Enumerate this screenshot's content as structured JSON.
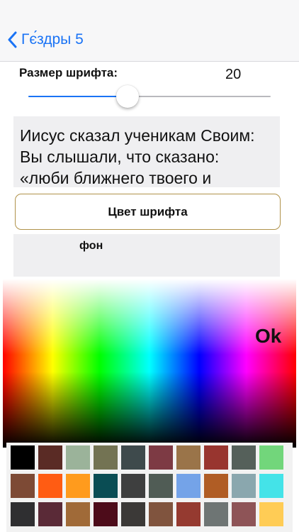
{
  "nav": {
    "back_label": "Гє́здры 5",
    "back_icon": "chevron-left-icon"
  },
  "font_size": {
    "label": "Размер шрифта:",
    "value": "20",
    "level": 0.41
  },
  "preview": {
    "text": "Иисус сказал ученикам Своим: Вы слышали, что сказано: «люби ближнего твоего и ненавидь врага твоего»."
  },
  "font_color_button": {
    "label": "Цвет шрифта"
  },
  "background": {
    "label": "фон"
  },
  "picker": {
    "ok_label": "Ok"
  },
  "swatches": [
    "#000000",
    "#5a2b25",
    "#9bb39a",
    "#737353",
    "#3e4a4c",
    "#7d3a44",
    "#9a7449",
    "#98352f",
    "#55605a",
    "#72d67b",
    "#7d4a35",
    "#ff5c13",
    "#ff9b1d",
    "#0a4d54",
    "#3e3f3f",
    "#505c55",
    "#74a3e8",
    "#b05d25",
    "#8aa7ae",
    "#44e3e8",
    "#2f2f31",
    "#5a2a37",
    "#a06a38",
    "#4d0c1a",
    "#3b3937",
    "#80543e",
    "#953a30",
    "#6e7574",
    "#8e5457",
    "#ffcc55"
  ]
}
